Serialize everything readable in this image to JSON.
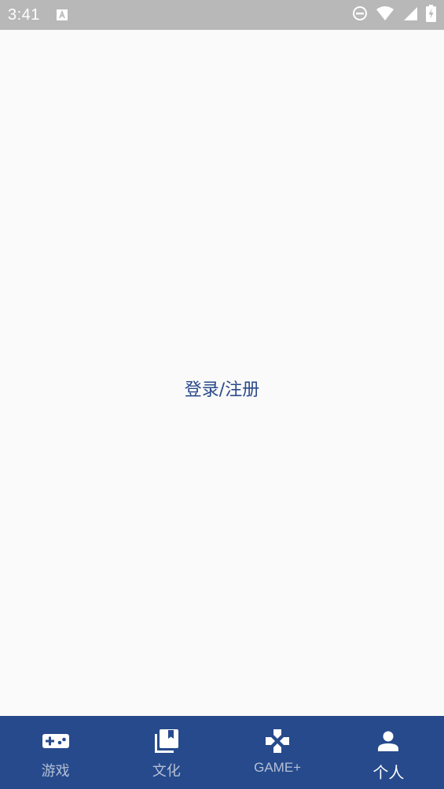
{
  "status_bar": {
    "time": "3:41",
    "icons": [
      "a-notification-icon",
      "do-not-disturb-icon",
      "wifi-icon",
      "signal-icon",
      "battery-charging-icon"
    ]
  },
  "main": {
    "login_link": "登录/注册"
  },
  "bottom_nav": {
    "items": [
      {
        "label": "游戏",
        "icon": "gamepad-icon",
        "active": false
      },
      {
        "label": "文化",
        "icon": "library-books-icon",
        "active": false
      },
      {
        "label": "GAME+",
        "icon": "dpad-icon",
        "active": false
      },
      {
        "label": "个人",
        "icon": "person-icon",
        "active": true
      }
    ]
  },
  "colors": {
    "nav_bg": "#264a8c",
    "status_bg": "#b8b8b8",
    "link": "#2a4a8a",
    "inactive_label": "#b6c0d6",
    "active_label": "#ffffff"
  }
}
